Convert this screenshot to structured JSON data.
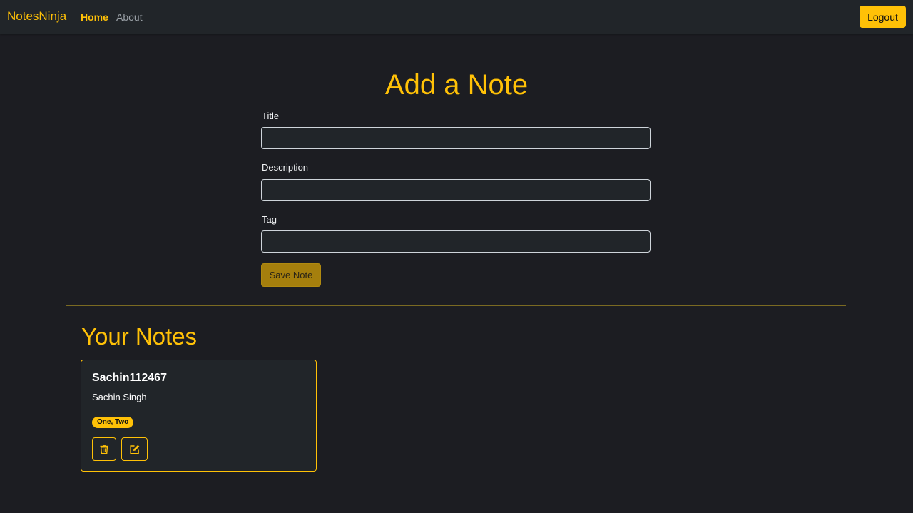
{
  "navbar": {
    "brand": "NotesNinja",
    "links": [
      {
        "label": "Home",
        "active": true
      },
      {
        "label": "About",
        "active": false
      }
    ],
    "logout_label": "Logout"
  },
  "add_note": {
    "heading": "Add a Note",
    "fields": [
      {
        "label": "Title",
        "value": ""
      },
      {
        "label": "Description",
        "value": ""
      },
      {
        "label": "Tag",
        "value": ""
      }
    ],
    "save_label": "Save Note"
  },
  "notes": {
    "heading": "Your Notes",
    "items": [
      {
        "title": "Sachin112467",
        "description": "Sachin Singh",
        "tag": "One, Two",
        "actions": [
          {
            "icon": "trash-icon"
          },
          {
            "icon": "edit-icon"
          }
        ]
      }
    ]
  },
  "colors": {
    "accent": "#ffc107",
    "background": "#1c1d22",
    "surface": "#212529"
  }
}
